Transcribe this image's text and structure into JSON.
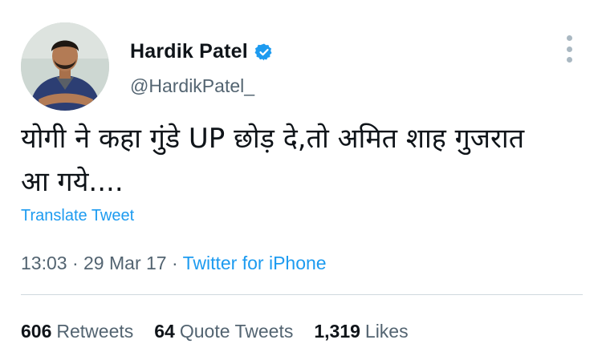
{
  "author": {
    "display_name": "Hardik Patel",
    "handle": "@HardikPatel_",
    "verified_icon": "verified-badge-icon",
    "avatar": "avatar-photo"
  },
  "tweet": {
    "text_line1": "योगी ने कहा गुंडे UP छोड़ दे,तो अमित शाह गुजरात",
    "text_line2": "आ गये....",
    "translate_label": "Translate Tweet"
  },
  "meta": {
    "time": "13:03",
    "sep1": " · ",
    "date": "29 Mar 17",
    "sep2": " · ",
    "source": "Twitter for iPhone"
  },
  "stats": {
    "retweets_count": "606",
    "retweets_label": "Retweets",
    "quotes_count": "64",
    "quotes_label": "Quote Tweets",
    "likes_count": "1,319",
    "likes_label": "Likes"
  },
  "colors": {
    "accent": "#1d9bf0",
    "secondary_text": "#536471",
    "primary_text": "#0f1419"
  },
  "more_icon": "more-vertical-icon"
}
